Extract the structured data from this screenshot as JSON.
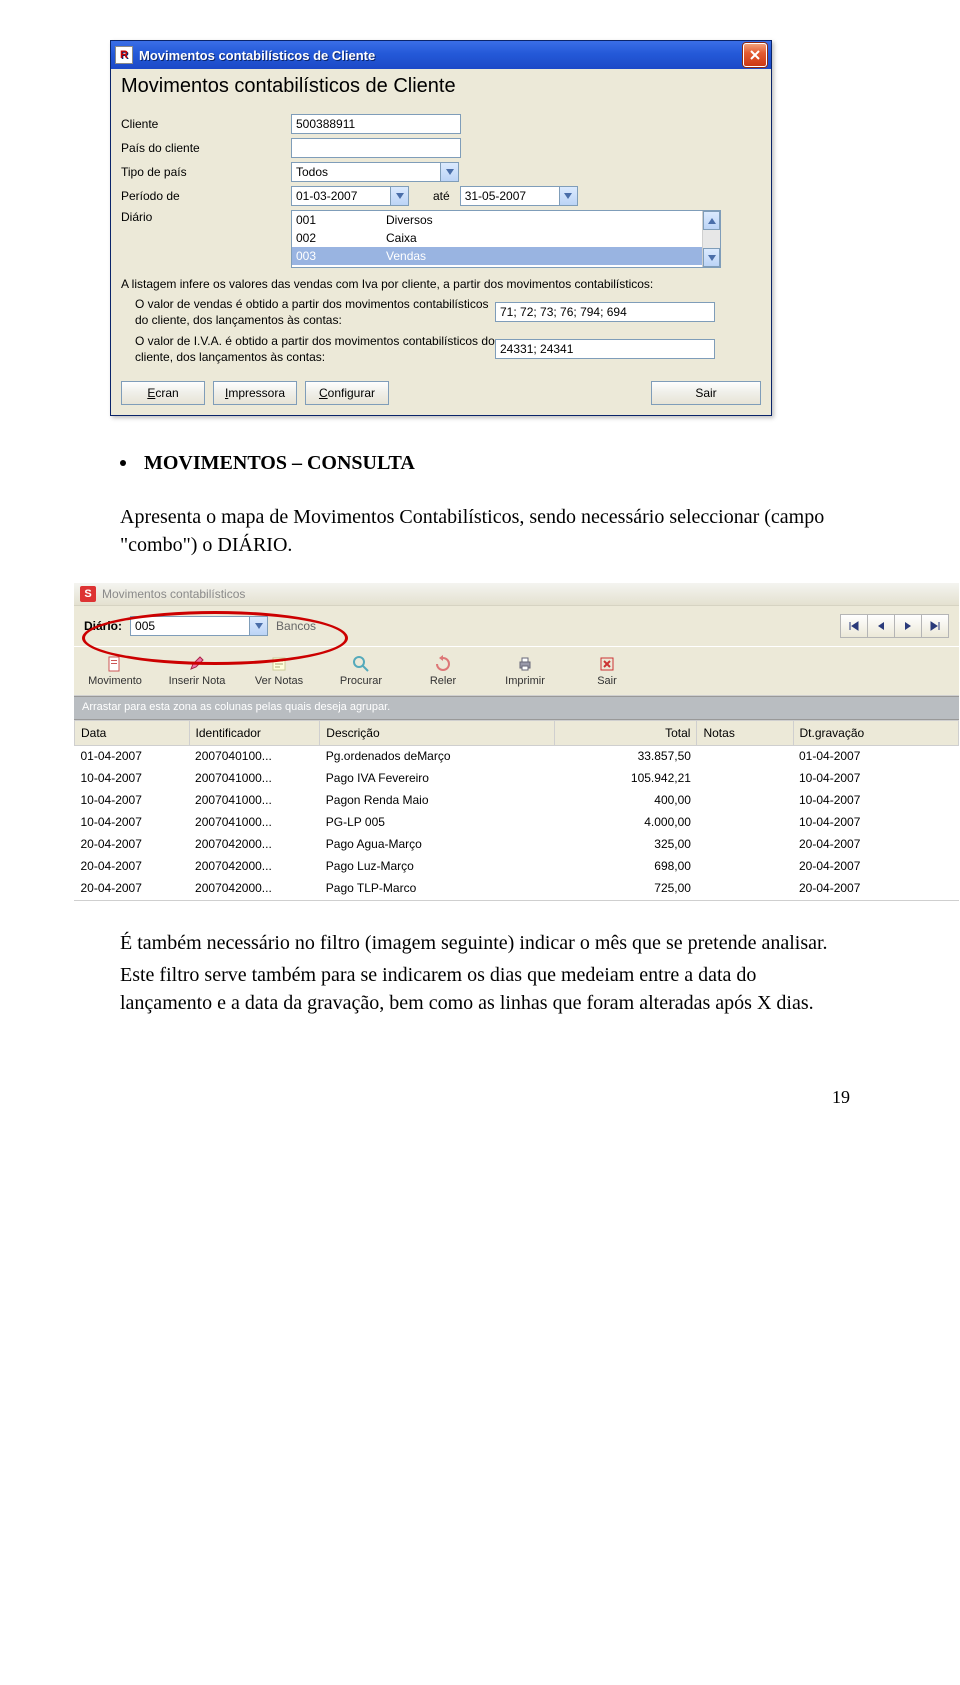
{
  "dialog1": {
    "title": "Movimentos contabilísticos de Cliente",
    "heading": "Movimentos contabilísticos de Cliente",
    "title_icon_letter": "R",
    "labels": {
      "cliente": "Cliente",
      "pais": "País do cliente",
      "tipo_pais": "Tipo de país",
      "periodo_de": "Período de",
      "ate": "até",
      "diario": "Diário"
    },
    "values": {
      "cliente": "500388911",
      "pais": "",
      "tipo_pais": "Todos",
      "periodo_de": "01-03-2007",
      "periodo_ate": "31-05-2007"
    },
    "diario_list": [
      {
        "code": "001",
        "name": "Diversos",
        "selected": false
      },
      {
        "code": "002",
        "name": "Caixa",
        "selected": false
      },
      {
        "code": "003",
        "name": "Vendas",
        "selected": true
      }
    ],
    "info_line": "A listagem infere os valores das vendas com Iva por cliente, a partir dos movimentos contabilísticos:",
    "sub1": "O valor de vendas é obtido a partir dos movimentos contabilísticos do cliente, dos lançamentos às contas:",
    "sub1_value": "71; 72; 73; 76; 794; 694",
    "sub2": "O valor de I.V.A. é obtido a partir dos movimentos contabilísticos do cliente, dos lançamentos às contas:",
    "sub2_value": "24331; 24341",
    "buttons": {
      "ecran": "cran",
      "impressora": "mpressora",
      "configurar": "onfigurar",
      "sair": "Sair"
    }
  },
  "body_text": {
    "bullet_title": "MOVIMENTOS – CONSULTA",
    "para1": "Apresenta o mapa de Movimentos Contabilísticos, sendo necessário seleccionar (campo \"combo\") o DIÁRIO.",
    "para2": "É também necessário no filtro (imagem seguinte) indicar o mês que se pretende analisar.",
    "para3": "Este filtro serve também para se indicarem os dias que medeiam entre a data do lançamento e a data da gravação, bem como as linhas que foram alteradas após X dias.",
    "page_num": "19"
  },
  "window2": {
    "title": "Movimentos contabilísticos",
    "title_icon_letter": "S",
    "filter": {
      "label": "Diário:",
      "value": "005",
      "resolved": "Bancos"
    },
    "toolbar": [
      {
        "id": "movimento",
        "label": "Movimento"
      },
      {
        "id": "inserirnota",
        "label": "Inserir Nota"
      },
      {
        "id": "vernotas",
        "label": "Ver Notas"
      },
      {
        "id": "procurar",
        "label": "Procurar"
      },
      {
        "id": "reler",
        "label": "Reler"
      },
      {
        "id": "imprimir",
        "label": "Imprimir"
      },
      {
        "id": "sair",
        "label": "Sair"
      }
    ],
    "grouping_text": "Arrastar para esta zona as colunas pelas quais deseja agrupar.",
    "columns": {
      "data": "Data",
      "identificador": "Identificador",
      "descricao": "Descrição",
      "total": "Total",
      "notas": "Notas",
      "dtgrav": "Dt.gravação"
    },
    "rows": [
      {
        "data": "01-04-2007",
        "id": "2007040100...",
        "desc": "Pg.ordenados deMarço",
        "total": "33.857,50",
        "notas": "",
        "dtgrav": "01-04-2007"
      },
      {
        "data": "10-04-2007",
        "id": "2007041000...",
        "desc": "Pago IVA Fevereiro",
        "total": "105.942,21",
        "notas": "",
        "dtgrav": "10-04-2007"
      },
      {
        "data": "10-04-2007",
        "id": "2007041000...",
        "desc": "Pagon Renda Maio",
        "total": "400,00",
        "notas": "",
        "dtgrav": "10-04-2007"
      },
      {
        "data": "10-04-2007",
        "id": "2007041000...",
        "desc": "PG-LP 005",
        "total": "4.000,00",
        "notas": "",
        "dtgrav": "10-04-2007"
      },
      {
        "data": "20-04-2007",
        "id": "2007042000...",
        "desc": "Pago Agua-Março",
        "total": "325,00",
        "notas": "",
        "dtgrav": "20-04-2007"
      },
      {
        "data": "20-04-2007",
        "id": "2007042000...",
        "desc": "Pago Luz-Março",
        "total": "698,00",
        "notas": "",
        "dtgrav": "20-04-2007"
      },
      {
        "data": "20-04-2007",
        "id": "2007042000...",
        "desc": "Pago TLP-Marco",
        "total": "725,00",
        "notas": "",
        "dtgrav": "20-04-2007"
      }
    ]
  }
}
